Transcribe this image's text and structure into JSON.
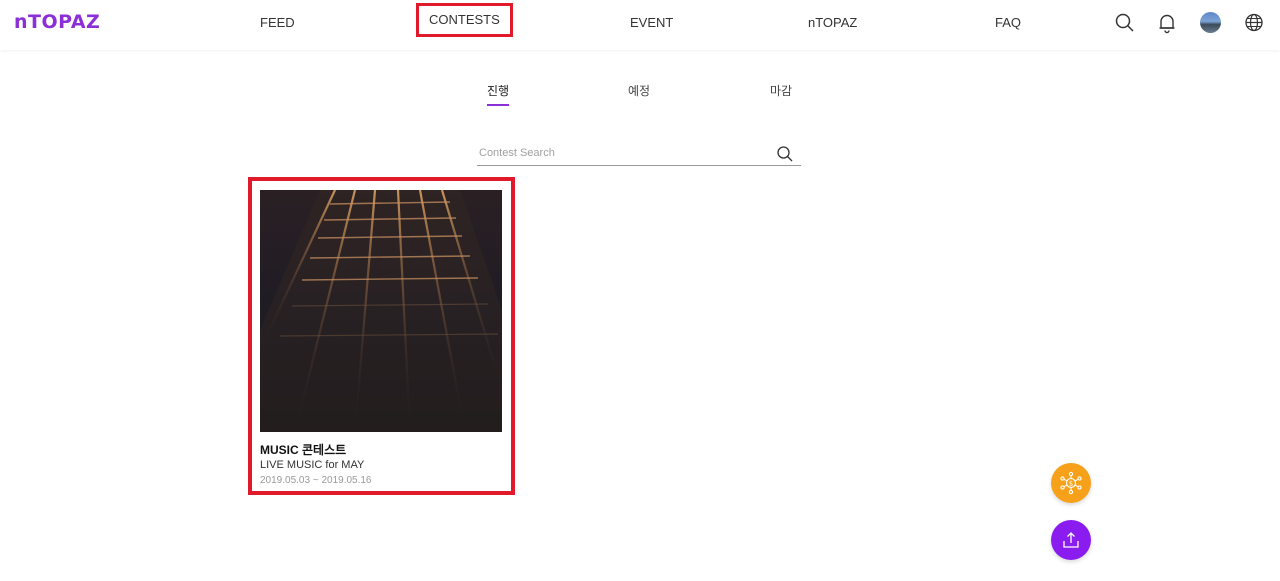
{
  "header": {
    "logo": "nTOPAZ",
    "nav": [
      {
        "label": "FEED"
      },
      {
        "label": "CONTESTS"
      },
      {
        "label": "EVENT"
      },
      {
        "label": "nTOPAZ"
      },
      {
        "label": "FAQ"
      }
    ],
    "icons": [
      "search-icon",
      "bell-icon",
      "avatar",
      "globe-icon"
    ]
  },
  "tabs": [
    {
      "label": "진행"
    },
    {
      "label": "예정"
    },
    {
      "label": "마감"
    }
  ],
  "search": {
    "placeholder": "Contest Search",
    "value": ""
  },
  "contests": [
    {
      "title": "MUSIC 콘테스트",
      "subtitle": "LIVE MUSIC for MAY",
      "date": "2019.05.03 ~ 2019.05.16"
    }
  ],
  "fabs": [
    {
      "icon": "network-dollar-icon",
      "color": "#f7a11a"
    },
    {
      "icon": "upload-icon",
      "color": "#8b1cf0"
    }
  ],
  "colors": {
    "accent": "#8b2fd9",
    "highlight": "#e11a2b"
  }
}
